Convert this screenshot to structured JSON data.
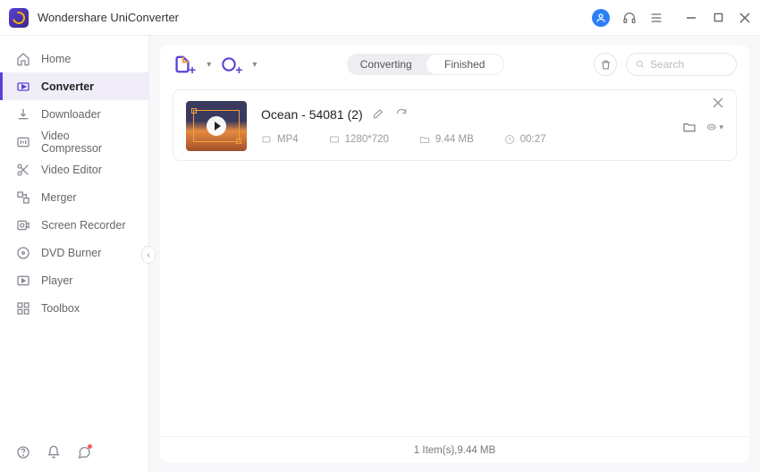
{
  "app": {
    "title": "Wondershare UniConverter"
  },
  "sidebar": {
    "items": [
      {
        "label": "Home"
      },
      {
        "label": "Converter"
      },
      {
        "label": "Downloader"
      },
      {
        "label": "Video Compressor"
      },
      {
        "label": "Video Editor"
      },
      {
        "label": "Merger"
      },
      {
        "label": "Screen Recorder"
      },
      {
        "label": "DVD Burner"
      },
      {
        "label": "Player"
      },
      {
        "label": "Toolbox"
      }
    ],
    "active_index": 1
  },
  "tabs": {
    "converting": "Converting",
    "finished": "Finished",
    "active": "finished"
  },
  "search": {
    "placeholder": "Search"
  },
  "file": {
    "title": "Ocean - 54081 (2)",
    "format": "MP4",
    "resolution": "1280*720",
    "size": "9.44 MB",
    "duration": "00:27"
  },
  "status": {
    "summary": "1 Item(s),9.44 MB"
  }
}
